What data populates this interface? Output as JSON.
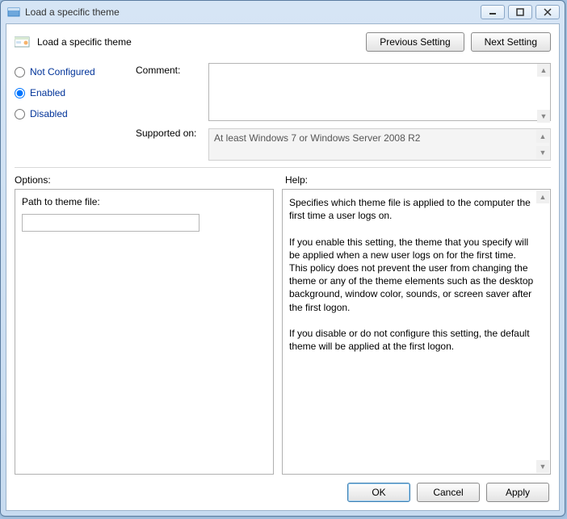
{
  "window": {
    "title": "Load a specific theme"
  },
  "header": {
    "title": "Load a specific theme",
    "prev_button": "Previous Setting",
    "next_button": "Next Setting"
  },
  "state": {
    "not_configured_label": "Not Configured",
    "enabled_label": "Enabled",
    "disabled_label": "Disabled",
    "selected": "enabled"
  },
  "labels": {
    "comment": "Comment:",
    "supported": "Supported on:",
    "options": "Options:",
    "help": "Help:"
  },
  "fields": {
    "comment_value": "",
    "supported_value": "At least Windows 7 or Windows Server 2008 R2"
  },
  "options": {
    "path_label": "Path to theme file:",
    "path_value": ""
  },
  "help": {
    "text": "Specifies which theme file is applied to the computer the first time a user logs on.\n\nIf you enable this setting, the theme that you specify will be applied when a new user logs on for the first time.  This policy does not prevent the user from changing the theme or any of the theme elements such as the desktop background, window color, sounds, or screen saver after the first logon.\n\nIf you disable or do not configure this setting, the default theme will be applied at the first logon."
  },
  "buttons": {
    "ok": "OK",
    "cancel": "Cancel",
    "apply": "Apply"
  }
}
